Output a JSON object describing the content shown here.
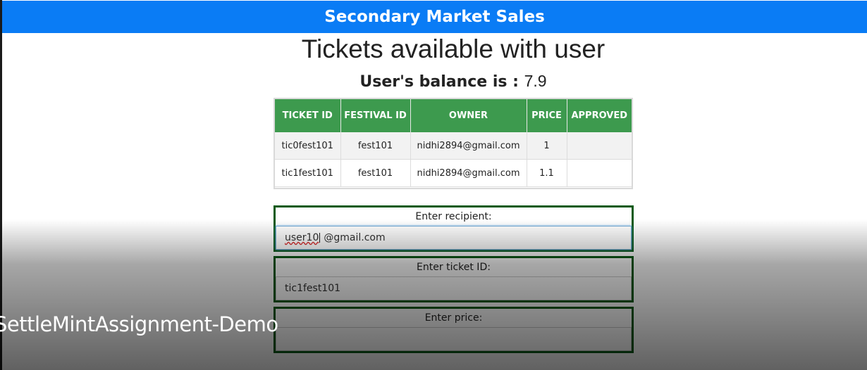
{
  "header": {
    "title": "Secondary Market Sales"
  },
  "page": {
    "heading": "Tickets available with user",
    "balance_label": "User's balance is :",
    "balance_value": "7.9"
  },
  "table": {
    "columns": [
      "TICKET ID",
      "FESTIVAL ID",
      "OWNER",
      "PRICE",
      "APPROVED"
    ],
    "rows": [
      {
        "ticket_id": "tic0fest101",
        "festival_id": "fest101",
        "owner": "nidhi2894@gmail.com",
        "price": "1",
        "approved": ""
      },
      {
        "ticket_id": "tic1fest101",
        "festival_id": "fest101",
        "owner": "nidhi2894@gmail.com",
        "price": "1.1",
        "approved": ""
      }
    ]
  },
  "form": {
    "recipient_label": "Enter recipient:",
    "recipient_value_a": "user10",
    "recipient_value_b": "@gmail.com",
    "ticket_label": "Enter ticket ID:",
    "ticket_value": "tic1fest101",
    "price_label": "Enter price:",
    "price_value": ""
  },
  "overlay": {
    "watermark": "SettleMintAssignment-Demo"
  },
  "colors": {
    "header": "#0a7cf5",
    "table_header": "#3d9a4e",
    "form_border": "#0a5a17"
  }
}
